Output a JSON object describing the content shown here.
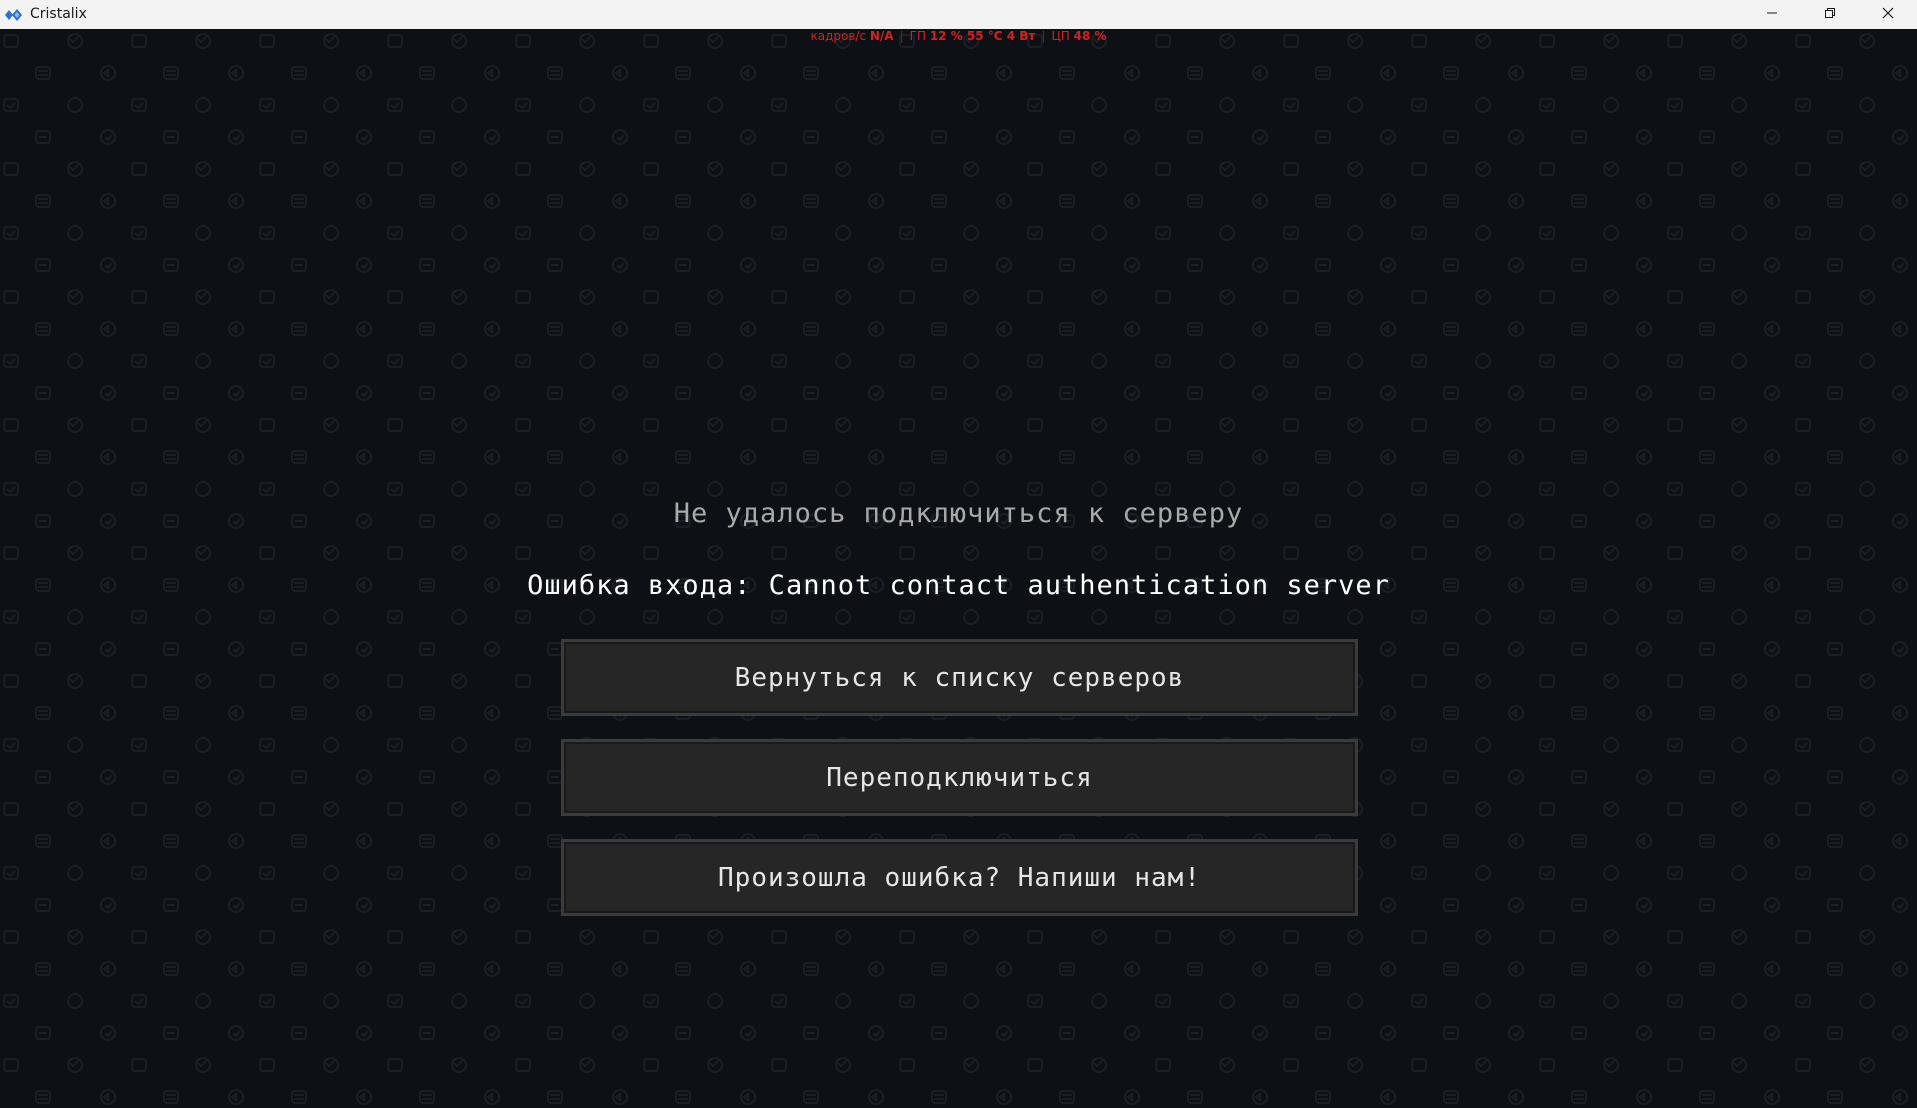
{
  "window": {
    "title": "Cristalix",
    "logo_color": "#2a6fdb"
  },
  "hud": {
    "fps_label": "кадров/с",
    "fps_value": "N/A",
    "gpu_label": "ГП",
    "gpu_value": "12 % 55 °C 4 Вт",
    "cpu_label": "ЦП",
    "cpu_value": "48 %",
    "color": "#d42020"
  },
  "screen": {
    "title": "Не удалось подключиться к серверу",
    "error": "Ошибка входа: Cannot contact authentication server"
  },
  "buttons": {
    "back_to_servers": "Вернуться к списку серверов",
    "reconnect": "Переподключиться",
    "report_error": "Произошла ошибка? Напиши нам!"
  },
  "icons": {
    "app_logo": "cristalix-diamond-icon",
    "minimize": "minimize-icon",
    "restore": "restore-icon",
    "close": "close-icon"
  }
}
